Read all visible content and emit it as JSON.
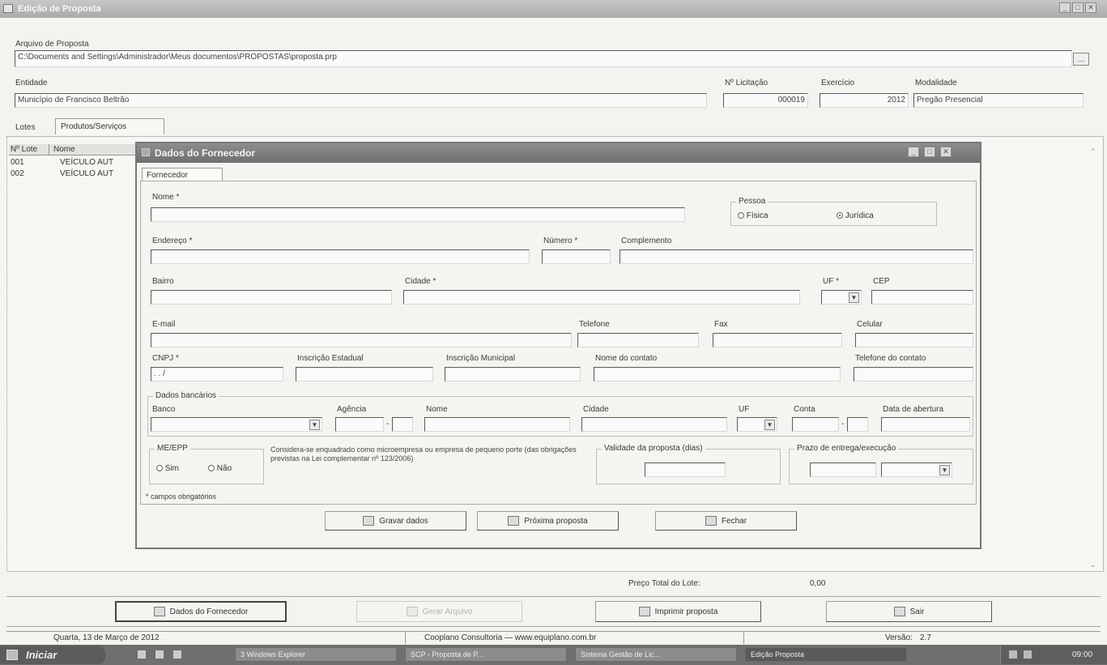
{
  "main_window": {
    "title": "Edição de Proposta",
    "arquivo_label": "Arquivo de Proposta",
    "arquivo_value": "C:\\Documents and Settings\\Administrador\\Meus documentos\\PROPOSTAS\\proposta.prp",
    "entidade_label": "Entidade",
    "entidade_value": "Município de Francisco Beltrão",
    "licitacao_label": "Nº Licitação",
    "licitacao_value": "000019",
    "exercicio_label": "Exercício",
    "exercicio_value": "2012",
    "modalidade_label": "Modalidade",
    "modalidade_value": "Pregão Presencial",
    "tabs": [
      "Lotes",
      "Produtos/Serviços"
    ],
    "table_headers": [
      "Nº Lote",
      "Nome"
    ],
    "rows": [
      {
        "num": "001",
        "name": "VEÍCULO AUT"
      },
      {
        "num": "002",
        "name": "VEÍCULO AUT"
      }
    ],
    "total_label": "Preço Total do Lote:",
    "total_value": "0,00",
    "buttons": {
      "fornecedor": "Dados do Fornecedor",
      "gerar": "Gerar Arquivo",
      "imprimir": "Imprimir proposta",
      "sair": "Sair"
    },
    "status": {
      "date": "Quarta, 13 de Março de 2012",
      "company": "Cooplano Consultoria — www.equiplano.com.br",
      "version_label": "Versão:",
      "version_value": "2.7"
    }
  },
  "dialog": {
    "title": "Dados do Fornecedor",
    "tab": "Fornecedor",
    "nome_label": "Nome *",
    "pessoa_label": "Pessoa",
    "pessoa_options": [
      "Física",
      "Jurídica"
    ],
    "pessoa_selected": "Jurídica",
    "endereco_label": "Endereço *",
    "numero_label": "Número *",
    "complemento_label": "Complemento",
    "bairro_label": "Bairro",
    "cidade_label": "Cidade *",
    "uf_label": "UF *",
    "cep_label": "CEP",
    "email_label": "E-mail",
    "telefone_label": "Telefone",
    "fax_label": "Fax",
    "celular_label": "Celular",
    "cnpj_label": "CNPJ *",
    "cnpj_value": "  .   .   /",
    "inscricao_estadual_label": "Inscrição Estadual",
    "inscricao_municipal_label": "Inscrição Municipal",
    "representante_label": "Nome do contato",
    "telefone_contato_label": "Telefone do contato",
    "dados_bancarios_label": "Dados bancários",
    "banco_label": "Banco",
    "agencia_label": "Agência",
    "agencia_sep": "-",
    "nome_banco_label": "Nome",
    "cidade_banco_label": "Cidade",
    "uf_banco_label": "UF",
    "conta_label": "Conta",
    "conta_sep": "-",
    "data_label": "Data de abertura",
    "me_epp_label": "ME/EPP",
    "me_options": [
      "Sim",
      "Não"
    ],
    "me_text": "Considera-se enquadrado como microempresa ou empresa de pequeno porte (das obrigações previstas na Lei complementar nº 123/2006)",
    "validade_label": "Validade da proposta (dias)",
    "prazo_label": "Prazo de entrega/execução",
    "required_note": "* campos obrigatórios",
    "buttons": {
      "gravar": "Gravar dados",
      "proxima": "Próxima proposta",
      "fechar": "Fechar"
    }
  },
  "taskbar": {
    "start": "Iniciar",
    "items": [
      "3 Windows Explorer",
      "SCP - Proposta de P...",
      "Sistema Gestão de Lic...",
      "Edição Proposta"
    ],
    "clock": "09:00"
  }
}
